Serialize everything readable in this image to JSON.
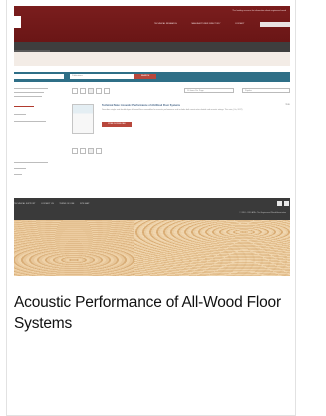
{
  "card": {
    "title": "Acoustic Performance of All-Wood Floor Systems"
  },
  "thumbnail": {
    "header": {
      "tagline": "The leading resource for information about engineered wood",
      "top_links": [
        "TECHNICAL RESEARCH",
        "MANUFACTURER DIRECTORY",
        "CONTACT"
      ]
    },
    "nav": [
      "RESOURCE LIBRARY",
      "RESOURCE BUILD",
      "ABOUT US",
      "FEATURED SITES"
    ],
    "search": {
      "select_value": "Publications",
      "button_label": "SEARCH"
    },
    "results": {
      "per_page": "10 Items Per Page",
      "sort": "Popular",
      "item_title": "Technical Note: Acoustic Performance of All-Wood Floor Systems",
      "item_desc": "Describes single- and double-layer all-wood floor assemblies for acoustic performance and includes both construction details and acoustic ratings. This note, (Co, 2017)",
      "download_label": "FREE DOWNLOAD",
      "item_meta": "TD/D"
    },
    "footer": {
      "links": [
        "TECHNICAL SUPPORT",
        "CONTACT US",
        "TERMS OF USE",
        "SITE MAP"
      ],
      "copyright": "© 2018 - 2019 APA - The Engineered Wood Association"
    }
  },
  "colors": {
    "header": "#7a1d1d",
    "nav": "#3e3e3e",
    "search_bar": "#2f6f87",
    "accent": "#b8473c",
    "footer": "#3a3a3a"
  }
}
